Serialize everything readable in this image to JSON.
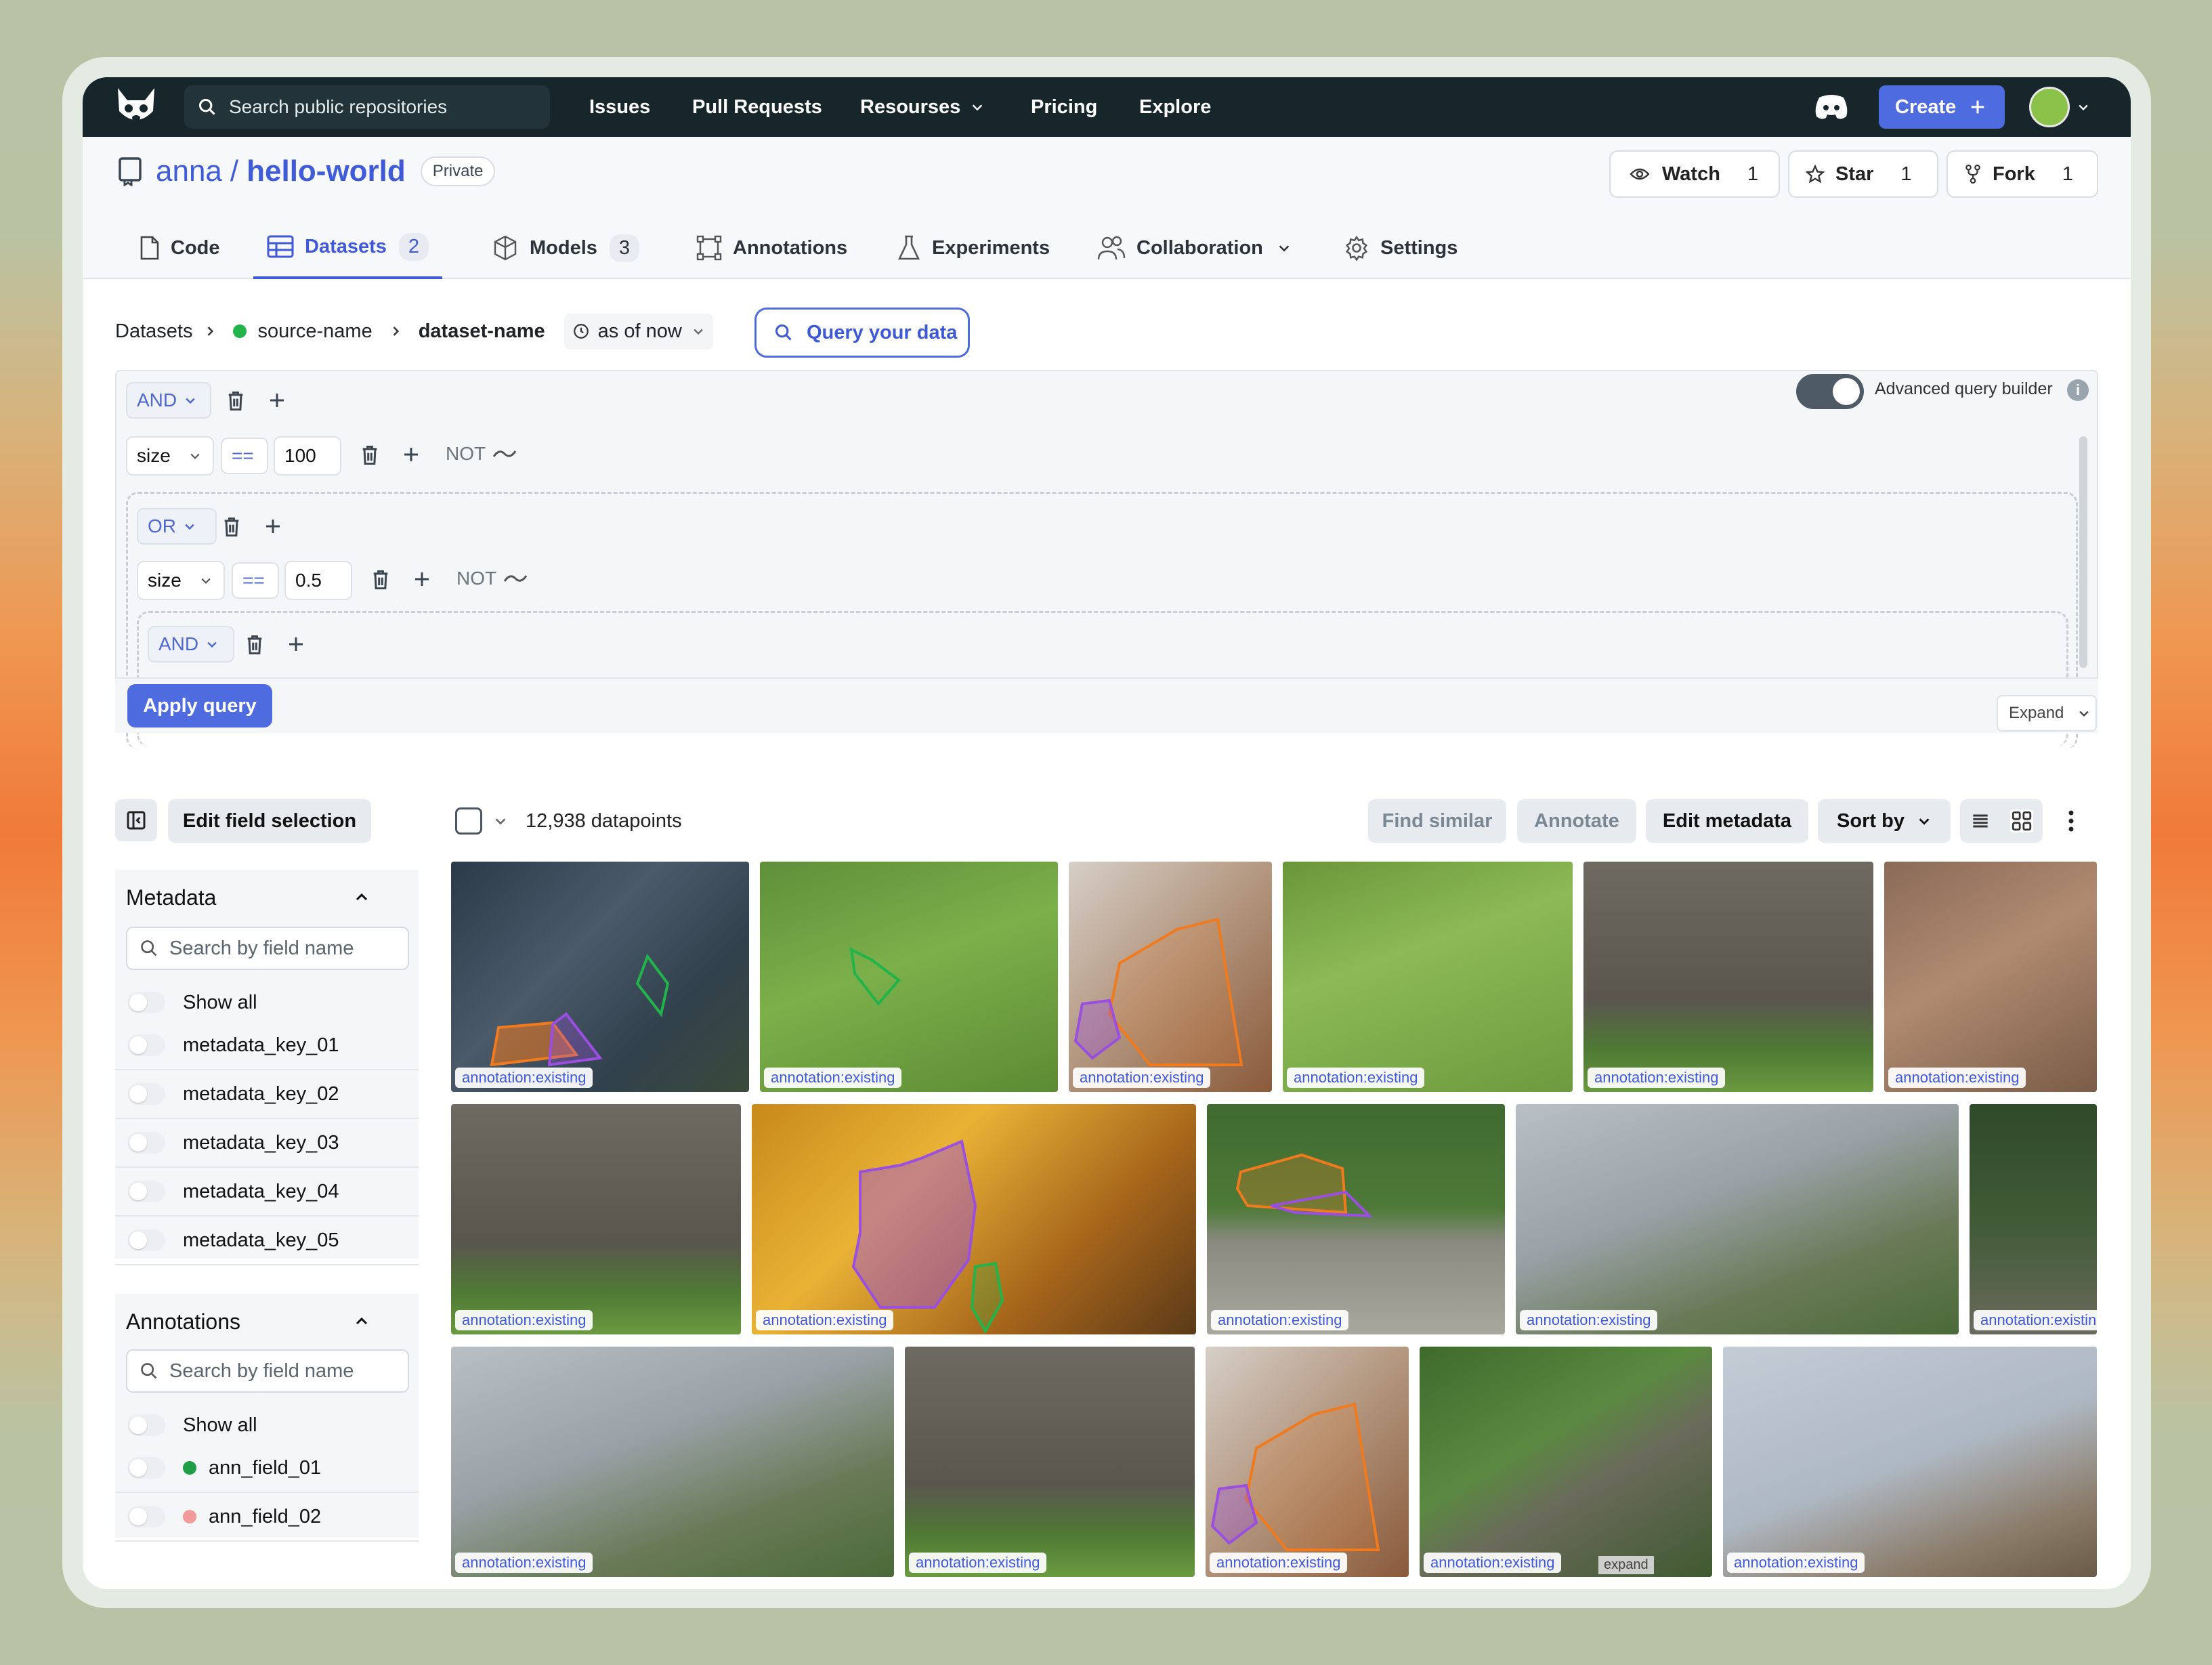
{
  "nav": {
    "search_placeholder": "Search public repositories",
    "items": [
      "Issues",
      "Pull Requests",
      "Resourses",
      "Pricing",
      "Explore"
    ],
    "create_label": "Create"
  },
  "repo": {
    "owner": "anna",
    "sep": "/",
    "name": "hello-world",
    "visibility": "Private",
    "watch": {
      "label": "Watch",
      "count": "1"
    },
    "star": {
      "label": "Star",
      "count": "1"
    },
    "fork": {
      "label": "Fork",
      "count": "1"
    }
  },
  "tabs": [
    {
      "label": "Code"
    },
    {
      "label": "Datasets",
      "count": "2"
    },
    {
      "label": "Models",
      "count": "3"
    },
    {
      "label": "Annotations"
    },
    {
      "label": "Experiments"
    },
    {
      "label": "Collaboration"
    },
    {
      "label": "Settings"
    }
  ],
  "breadcrumb": {
    "root": "Datasets",
    "source": "source-name",
    "dataset": "dataset-name",
    "version": "as of now"
  },
  "query_button": "Query your data",
  "query": {
    "root_op": "AND",
    "cond1": {
      "field": "size",
      "op": "==",
      "value": "100",
      "not": "NOT"
    },
    "group_op": "OR",
    "cond2": {
      "field": "size",
      "op": "==",
      "value": "0.5",
      "not": "NOT"
    },
    "inner_op": "AND",
    "apply": "Apply query",
    "expand": "Expand",
    "advanced": "Advanced query builder",
    "advanced_on": true
  },
  "sidebar": {
    "edit_fields": "Edit field selection",
    "metadata": {
      "title": "Metadata",
      "search_placeholder": "Search by field name",
      "show_all": "Show all",
      "fields": [
        "metadata_key_01",
        "metadata_key_02",
        "metadata_key_03",
        "metadata_key_04",
        "metadata_key_05"
      ]
    },
    "annotations": {
      "title": "Annotations",
      "search_placeholder": "Search by field name",
      "show_all": "Show all",
      "fields": [
        {
          "name": "ann_field_01",
          "color": "#1f9d47"
        },
        {
          "name": "ann_field_02",
          "color": "#f39a9a"
        }
      ]
    }
  },
  "grid": {
    "count": "12,938 datapoints",
    "find_similar": "Find similar",
    "annotate": "Annotate",
    "edit_metadata": "Edit metadata",
    "sort_by": "Sort by",
    "tag": "annotation:existing",
    "expand_hint": "expand"
  },
  "colors": {
    "accent": "#4f6be0",
    "nav_bg": "#17262b",
    "ann_orange": "#f07a1e",
    "ann_purple": "#9a4fe0",
    "ann_green": "#22b44a"
  }
}
